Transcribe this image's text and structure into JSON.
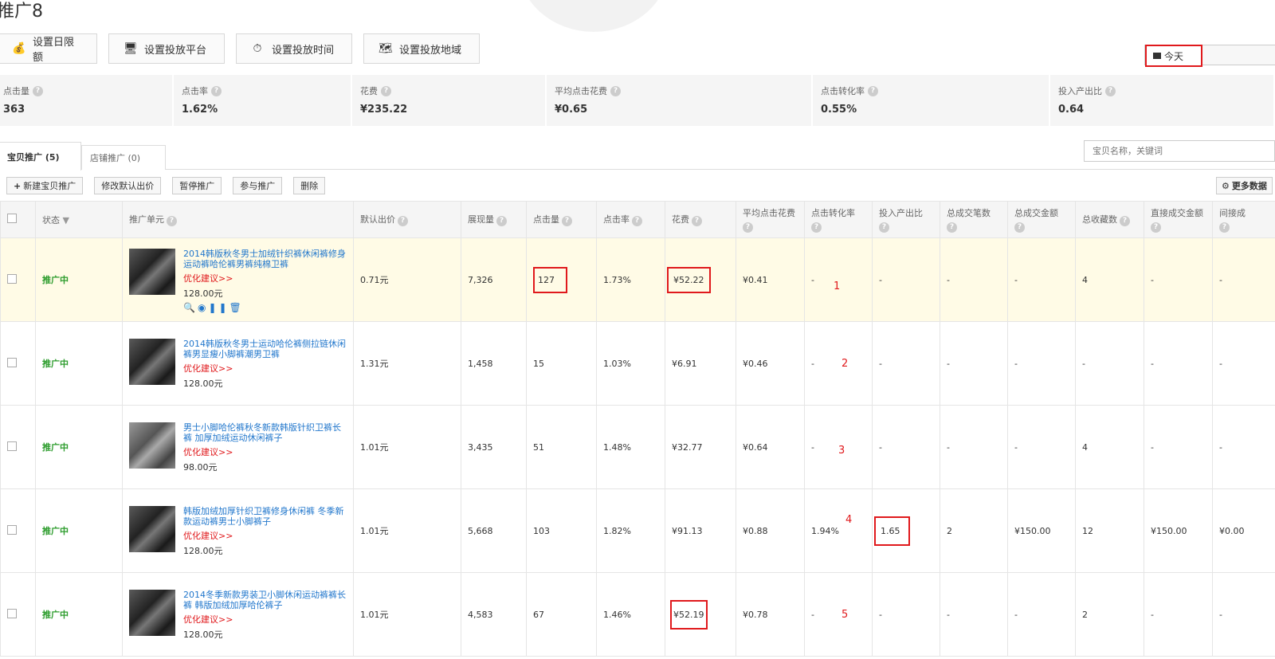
{
  "page_title": "推广8",
  "actions": [
    {
      "label": "设置日限额",
      "icon": "money-bag-icon",
      "glyph": "💰"
    },
    {
      "label": "设置投放平台",
      "icon": "monitor-icon",
      "glyph": "🖥"
    },
    {
      "label": "设置投放时间",
      "icon": "clock-icon",
      "glyph": "⏱"
    },
    {
      "label": "设置投放地域",
      "icon": "map-icon",
      "glyph": "🗺"
    }
  ],
  "date_select": {
    "value": "今天"
  },
  "stats": [
    {
      "label": "点击量",
      "value": "363"
    },
    {
      "label": "点击率",
      "value": "1.62%"
    },
    {
      "label": "花费",
      "value": "¥235.22"
    },
    {
      "label": "平均点击花费",
      "value": "¥0.65"
    },
    {
      "label": "点击转化率",
      "value": "0.55%"
    },
    {
      "label": "投入产出比",
      "value": "0.64"
    }
  ],
  "tabs": [
    {
      "label": "宝贝推广 (5)"
    },
    {
      "label": "店铺推广 (0)"
    }
  ],
  "search": {
    "placeholder": "宝贝名称，关键词"
  },
  "toolbar": {
    "new": "新建宝贝推广",
    "modify": "修改默认出价",
    "pause": "暂停推广",
    "join": "参与推广",
    "delete": "删除",
    "more": "更多数据"
  },
  "columns": {
    "status": "状态",
    "unit": "推广单元",
    "bid": "默认出价",
    "impressions": "展现量",
    "clicks": "点击量",
    "ctr": "点击率",
    "cost": "花费",
    "cpc": "平均点击花费",
    "cvr": "点击转化率",
    "roi": "投入产出比",
    "orders": "总成交笔数",
    "gmv": "总成交金额",
    "favorites": "总收藏数",
    "direct_gmv": "直接成交金额",
    "indirect_gmv": "间接成"
  },
  "rows": [
    {
      "status": "推广中",
      "title": "2014韩版秋冬男士加绒针织裤休闲裤修身运动裤哈伦裤男裤纯棉卫裤",
      "opt": "优化建议>>",
      "price": "128.00元",
      "bid": "0.71元",
      "impressions": "7,326",
      "clicks": "127",
      "ctr": "1.73%",
      "cost": "¥52.22",
      "cpc": "¥0.41",
      "cvr": "-",
      "roi": "-",
      "orders": "-",
      "gmv": "-",
      "favorites": "4",
      "direct_gmv": "-",
      "indirect_gmv": "-",
      "note": "1"
    },
    {
      "status": "推广中",
      "title": "2014韩版秋冬男士运动哈伦裤侧拉链休闲裤男显瘦小脚裤潮男卫裤",
      "opt": "优化建议>>",
      "price": "128.00元",
      "bid": "1.31元",
      "impressions": "1,458",
      "clicks": "15",
      "ctr": "1.03%",
      "cost": "¥6.91",
      "cpc": "¥0.46",
      "cvr": "-",
      "roi": "-",
      "orders": "-",
      "gmv": "-",
      "favorites": "-",
      "direct_gmv": "-",
      "indirect_gmv": "-",
      "note": "2"
    },
    {
      "status": "推广中",
      "title": "男士小脚哈伦裤秋冬新款韩版针织卫裤长裤 加厚加绒运动休闲裤子",
      "opt": "优化建议>>",
      "price": "98.00元",
      "bid": "1.01元",
      "impressions": "3,435",
      "clicks": "51",
      "ctr": "1.48%",
      "cost": "¥32.77",
      "cpc": "¥0.64",
      "cvr": "-",
      "roi": "-",
      "orders": "-",
      "gmv": "-",
      "favorites": "4",
      "direct_gmv": "-",
      "indirect_gmv": "-",
      "note": "3"
    },
    {
      "status": "推广中",
      "title": "韩版加绒加厚针织卫裤修身休闲裤 冬季新款运动裤男士小脚裤子",
      "opt": "优化建议>>",
      "price": "128.00元",
      "bid": "1.01元",
      "impressions": "5,668",
      "clicks": "103",
      "ctr": "1.82%",
      "cost": "¥91.13",
      "cpc": "¥0.88",
      "cvr": "1.94%",
      "roi": "1.65",
      "orders": "2",
      "gmv": "¥150.00",
      "favorites": "12",
      "direct_gmv": "¥150.00",
      "indirect_gmv": "¥0.00",
      "note": "4"
    },
    {
      "status": "推广中",
      "title": "2014冬季新款男装卫小脚休闲运动裤裤长裤 韩版加绒加厚哈伦裤子",
      "opt": "优化建议>>",
      "price": "128.00元",
      "bid": "1.01元",
      "impressions": "4,583",
      "clicks": "67",
      "ctr": "1.46%",
      "cost": "¥52.19",
      "cpc": "¥0.78",
      "cvr": "-",
      "roi": "-",
      "orders": "-",
      "gmv": "-",
      "favorites": "2",
      "direct_gmv": "-",
      "indirect_gmv": "-",
      "note": "5"
    }
  ],
  "colors": {
    "accent": "#2277cc",
    "status_green": "#2c9c2c",
    "highlight_red": "#e0191c"
  }
}
